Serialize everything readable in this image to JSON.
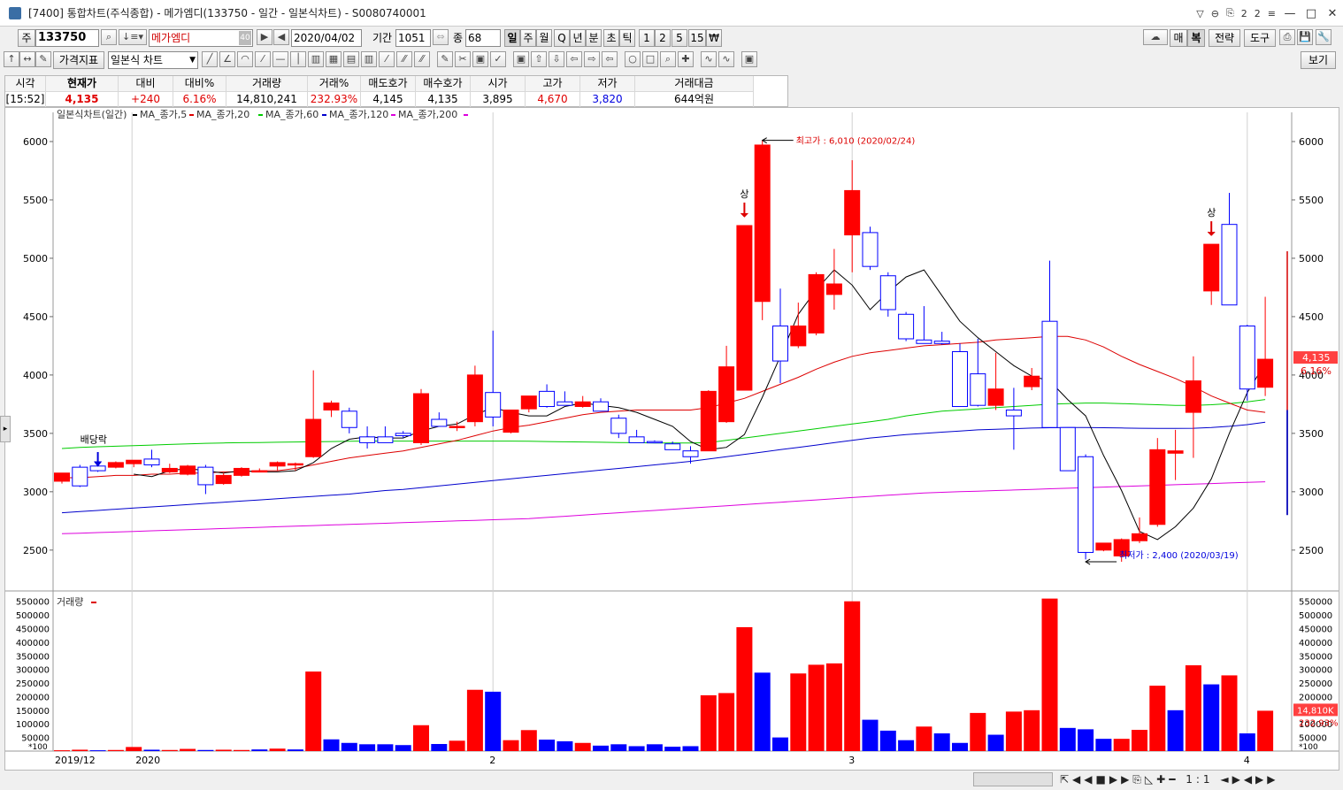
{
  "window": {
    "title": "[7400] 통합차트(주식종합) - 메가엠디(133750 - 일간 - 일본식차트) - S0080740001",
    "title_icons": [
      "▽",
      "⊖",
      "⎘",
      "2",
      "2",
      "≡"
    ],
    "min": "—",
    "max": "□",
    "close": "✕"
  },
  "toolbar1": {
    "code_prefix": "주",
    "code": "133750",
    "name": "메가엠디",
    "name_badge": "40",
    "date": "2020/04/02",
    "period_label": "기간",
    "period": "1051",
    "count_label": "종",
    "count": "68",
    "periods": [
      "일",
      "주",
      "월",
      "Q",
      "년",
      "분",
      "초",
      "틱",
      "1",
      "2",
      "5",
      "15",
      "₩"
    ],
    "right_buttons": [
      "매",
      "복",
      "전략",
      "도구"
    ]
  },
  "toolbar2": {
    "indicator_label": "가격지표",
    "chart_type": "일본식 차트",
    "view_button": "보기"
  },
  "quote": {
    "headers": [
      "시각",
      "현재가",
      "대비",
      "대비%",
      "거래량",
      "거래%",
      "매도호가",
      "매수호가",
      "시가",
      "고가",
      "저가",
      "거래대금"
    ],
    "values": [
      "[15:52]",
      "4,135",
      "+240",
      "6.16%",
      "14,810,241",
      "232.93%",
      "4,145",
      "4,135",
      "3,895",
      "4,670",
      "3,820",
      "644억원"
    ]
  },
  "colors": {
    "up": "#ff0000",
    "down": "#0000ff",
    "ma5": "#000000",
    "ma20": "#dd0000",
    "ma60": "#00cc00",
    "ma120": "#0000cc",
    "ma200": "#dd00dd"
  },
  "chart_data": {
    "type": "candlestick",
    "title": "일본식차트(일간)",
    "legend": [
      "MA_종가,5",
      "MA_종가,20",
      "MA_종가,60",
      "MA_종가,120",
      "MA_종가,200"
    ],
    "y_ticks": [
      6000,
      5500,
      5000,
      4500,
      4000,
      3500,
      3000,
      2500
    ],
    "ylim": [
      2150,
      6250
    ],
    "vol_label": "거래량",
    "vol_ticks": [
      "550000",
      "500000",
      "450000",
      "400000",
      "350000",
      "300000",
      "250000",
      "200000",
      "150000",
      "100000",
      "50000"
    ],
    "vol_ticks_right": [
      "550000",
      "500000",
      "450000",
      "400000",
      "350000",
      "300000",
      "250000",
      "200000",
      "150000",
      "100000",
      "50000"
    ],
    "vol_unit": "*100",
    "vol_max": 575000,
    "x_labels": [
      "2019/12",
      "2020",
      "2",
      "3",
      "4"
    ],
    "annotations": {
      "high": "최고가 : 6,010 (2020/02/24)",
      "low": "최저가 : 2,400 (2020/03/19)",
      "dividend": "배당락",
      "limit_up_1": "상",
      "limit_up_2": "상"
    },
    "last_price_tag": "4,135",
    "last_pct_tag": "6.16%",
    "last_vol_tag": "14,810K",
    "last_volpct_tag": "232.93%",
    "candles": [
      {
        "o": 3090,
        "h": 3160,
        "l": 3070,
        "c": 3160
      },
      {
        "o": 3210,
        "h": 3230,
        "l": 3040,
        "c": 3050
      },
      {
        "o": 3220,
        "h": 3240,
        "l": 3170,
        "c": 3180
      },
      {
        "o": 3210,
        "h": 3260,
        "l": 3200,
        "c": 3250
      },
      {
        "o": 3240,
        "h": 3270,
        "l": 3210,
        "c": 3270
      },
      {
        "o": 3280,
        "h": 3360,
        "l": 3210,
        "c": 3230
      },
      {
        "o": 3170,
        "h": 3240,
        "l": 3160,
        "c": 3200
      },
      {
        "o": 3150,
        "h": 3230,
        "l": 3140,
        "c": 3220
      },
      {
        "o": 3210,
        "h": 3230,
        "l": 2980,
        "c": 3060
      },
      {
        "o": 3070,
        "h": 3160,
        "l": 3060,
        "c": 3140
      },
      {
        "o": 3140,
        "h": 3210,
        "l": 3130,
        "c": 3200
      },
      {
        "o": 3180,
        "h": 3200,
        "l": 3170,
        "c": 3180
      },
      {
        "o": 3220,
        "h": 3260,
        "l": 3180,
        "c": 3250
      },
      {
        "o": 3240,
        "h": 3250,
        "l": 3180,
        "c": 3240
      },
      {
        "o": 3300,
        "h": 4040,
        "l": 3290,
        "c": 3620
      },
      {
        "o": 3700,
        "h": 3780,
        "l": 3640,
        "c": 3760
      },
      {
        "o": 3690,
        "h": 3720,
        "l": 3500,
        "c": 3550
      },
      {
        "o": 3470,
        "h": 3560,
        "l": 3370,
        "c": 3420
      },
      {
        "o": 3470,
        "h": 3560,
        "l": 3420,
        "c": 3420
      },
      {
        "o": 3500,
        "h": 3520,
        "l": 3460,
        "c": 3480
      },
      {
        "o": 3420,
        "h": 3880,
        "l": 3400,
        "c": 3840
      },
      {
        "o": 3620,
        "h": 3680,
        "l": 3560,
        "c": 3560
      },
      {
        "o": 3560,
        "h": 3600,
        "l": 3520,
        "c": 3560
      },
      {
        "o": 3600,
        "h": 4080,
        "l": 3560,
        "c": 4000
      },
      {
        "o": 3850,
        "h": 4380,
        "l": 3560,
        "c": 3640
      },
      {
        "o": 3510,
        "h": 3690,
        "l": 3500,
        "c": 3700
      },
      {
        "o": 3710,
        "h": 3790,
        "l": 3680,
        "c": 3820
      },
      {
        "o": 3860,
        "h": 3920,
        "l": 3720,
        "c": 3730
      },
      {
        "o": 3770,
        "h": 3860,
        "l": 3740,
        "c": 3740
      },
      {
        "o": 3730,
        "h": 3820,
        "l": 3720,
        "c": 3770
      },
      {
        "o": 3770,
        "h": 3800,
        "l": 3690,
        "c": 3690
      },
      {
        "o": 3630,
        "h": 3660,
        "l": 3460,
        "c": 3500
      },
      {
        "o": 3470,
        "h": 3530,
        "l": 3420,
        "c": 3420
      },
      {
        "o": 3430,
        "h": 3440,
        "l": 3420,
        "c": 3420
      },
      {
        "o": 3410,
        "h": 3430,
        "l": 3360,
        "c": 3360
      },
      {
        "o": 3350,
        "h": 3390,
        "l": 3240,
        "c": 3300
      },
      {
        "o": 3350,
        "h": 3870,
        "l": 3350,
        "c": 3860
      },
      {
        "o": 3600,
        "h": 4250,
        "l": 3590,
        "c": 4070
      },
      {
        "o": 3870,
        "h": 5280,
        "l": 3880,
        "c": 5280
      },
      {
        "o": 4630,
        "h": 6010,
        "l": 4470,
        "c": 5970
      },
      {
        "o": 4420,
        "h": 4740,
        "l": 3930,
        "c": 4120
      },
      {
        "o": 4250,
        "h": 4620,
        "l": 4230,
        "c": 4420
      },
      {
        "o": 4360,
        "h": 4880,
        "l": 4340,
        "c": 4860
      },
      {
        "o": 4690,
        "h": 5080,
        "l": 4560,
        "c": 4780
      },
      {
        "o": 5200,
        "h": 5840,
        "l": 4880,
        "c": 5580
      },
      {
        "o": 5220,
        "h": 5270,
        "l": 4900,
        "c": 4930
      },
      {
        "o": 4850,
        "h": 4880,
        "l": 4500,
        "c": 4560
      },
      {
        "o": 4520,
        "h": 4540,
        "l": 4290,
        "c": 4310
      },
      {
        "o": 4300,
        "h": 4590,
        "l": 4270,
        "c": 4270
      },
      {
        "o": 4290,
        "h": 4370,
        "l": 4260,
        "c": 4270
      },
      {
        "o": 4200,
        "h": 4270,
        "l": 3730,
        "c": 3730
      },
      {
        "o": 4010,
        "h": 4310,
        "l": 3730,
        "c": 3740
      },
      {
        "o": 3740,
        "h": 4190,
        "l": 3700,
        "c": 3880
      },
      {
        "o": 3700,
        "h": 3890,
        "l": 3360,
        "c": 3650
      },
      {
        "o": 3900,
        "h": 4060,
        "l": 3870,
        "c": 3990
      },
      {
        "o": 4460,
        "h": 4980,
        "l": 3550,
        "c": 3550
      },
      {
        "o": 3550,
        "h": 3550,
        "l": 3180,
        "c": 3180
      },
      {
        "o": 3300,
        "h": 3320,
        "l": 2420,
        "c": 2480
      },
      {
        "o": 2500,
        "h": 2560,
        "l": 2490,
        "c": 2560
      },
      {
        "o": 2450,
        "h": 2600,
        "l": 2400,
        "c": 2590
      },
      {
        "o": 2580,
        "h": 2780,
        "l": 2560,
        "c": 2640
      },
      {
        "o": 2720,
        "h": 3460,
        "l": 2700,
        "c": 3360
      },
      {
        "o": 3330,
        "h": 3530,
        "l": 3100,
        "c": 3350
      },
      {
        "o": 3680,
        "h": 4160,
        "l": 3290,
        "c": 3950
      },
      {
        "o": 4720,
        "h": 5120,
        "l": 4600,
        "c": 5120
      },
      {
        "o": 5290,
        "h": 5560,
        "l": 4680,
        "c": 4600
      },
      {
        "o": 4420,
        "h": 4430,
        "l": 3780,
        "c": 3880
      },
      {
        "o": 3895,
        "h": 4670,
        "l": 3820,
        "c": 4135
      }
    ],
    "volumes": [
      3000,
      5000,
      3000,
      4000,
      15000,
      5000,
      4000,
      8000,
      4000,
      5000,
      4000,
      6000,
      9000,
      6000,
      292000,
      43000,
      30000,
      25000,
      25000,
      22000,
      95000,
      26000,
      38000,
      225000,
      218000,
      40000,
      77000,
      42000,
      36000,
      30000,
      20000,
      25000,
      18000,
      25000,
      16000,
      18000,
      205000,
      213000,
      455000,
      288000,
      50000,
      285000,
      317000,
      322000,
      550000,
      115000,
      75000,
      40000,
      90000,
      65000,
      30000,
      140000,
      60000,
      145000,
      150000,
      560000,
      85000,
      80000,
      45000,
      45000,
      78000,
      240000,
      150000,
      315000,
      245000,
      278000,
      65000,
      148100
    ],
    "vol_up": [
      1,
      1,
      0,
      1,
      1,
      0,
      1,
      1,
      0,
      1,
      1,
      0,
      1,
      0,
      1,
      0,
      0,
      0,
      0,
      0,
      1,
      0,
      1,
      1,
      0,
      1,
      1,
      0,
      0,
      1,
      0,
      0,
      0,
      0,
      0,
      0,
      1,
      1,
      1,
      0,
      0,
      1,
      1,
      1,
      1,
      0,
      0,
      0,
      1,
      0,
      0,
      1,
      0,
      1,
      1,
      1,
      0,
      0,
      0,
      1,
      1,
      1,
      0,
      1,
      0,
      1,
      0,
      1
    ],
    "ma5": [
      null,
      null,
      null,
      null,
      3150,
      3130,
      3180,
      3200,
      3180,
      3160,
      3180,
      3170,
      3170,
      3180,
      3250,
      3370,
      3450,
      3470,
      3460,
      3460,
      3520,
      3560,
      3580,
      3660,
      3720,
      3680,
      3650,
      3650,
      3730,
      3760,
      3740,
      3720,
      3680,
      3620,
      3560,
      3430,
      3360,
      3380,
      3490,
      3810,
      4160,
      4520,
      4730,
      4900,
      4770,
      4560,
      4710,
      4840,
      4900,
      4680,
      4460,
      4320,
      4200,
      4080,
      3990,
      3950,
      3790,
      3650,
      3310,
      3010,
      2660,
      2590,
      2700,
      2860,
      3110,
      3500,
      3850,
      4100
    ],
    "ma20": [
      3120,
      3120,
      3130,
      3140,
      3140,
      3150,
      3150,
      3160,
      3160,
      3170,
      3170,
      3180,
      3180,
      3200,
      3230,
      3260,
      3290,
      3310,
      3330,
      3350,
      3380,
      3410,
      3440,
      3480,
      3520,
      3550,
      3570,
      3600,
      3630,
      3660,
      3680,
      3690,
      3700,
      3700,
      3700,
      3700,
      3720,
      3760,
      3800,
      3860,
      3920,
      3980,
      4050,
      4110,
      4160,
      4190,
      4210,
      4230,
      4250,
      4260,
      4270,
      4280,
      4300,
      4310,
      4320,
      4330,
      4330,
      4300,
      4240,
      4160,
      4090,
      4030,
      3970,
      3900,
      3820,
      3760,
      3700,
      3680
    ],
    "ma60": [
      3370,
      3380,
      3385,
      3390,
      3395,
      3400,
      3405,
      3410,
      3415,
      3418,
      3420,
      3422,
      3424,
      3426,
      3428,
      3430,
      3432,
      3434,
      3434,
      3434,
      3434,
      3434,
      3434,
      3434,
      3434,
      3434,
      3432,
      3430,
      3428,
      3426,
      3424,
      3422,
      3420,
      3418,
      3418,
      3418,
      3420,
      3440,
      3460,
      3480,
      3500,
      3520,
      3540,
      3560,
      3580,
      3600,
      3620,
      3650,
      3670,
      3690,
      3700,
      3710,
      3720,
      3730,
      3740,
      3750,
      3755,
      3760,
      3760,
      3755,
      3750,
      3745,
      3740,
      3740,
      3745,
      3755,
      3770,
      3790
    ],
    "ma120": [
      2820,
      2830,
      2840,
      2850,
      2860,
      2870,
      2880,
      2890,
      2900,
      2910,
      2920,
      2930,
      2940,
      2950,
      2960,
      2970,
      2980,
      2995,
      3010,
      3020,
      3035,
      3050,
      3065,
      3080,
      3095,
      3110,
      3125,
      3140,
      3155,
      3170,
      3185,
      3200,
      3215,
      3230,
      3245,
      3260,
      3280,
      3300,
      3320,
      3340,
      3360,
      3380,
      3400,
      3420,
      3440,
      3460,
      3475,
      3490,
      3500,
      3510,
      3520,
      3530,
      3535,
      3540,
      3545,
      3548,
      3550,
      3550,
      3548,
      3546,
      3544,
      3542,
      3542,
      3544,
      3550,
      3560,
      3575,
      3595
    ],
    "ma200": [
      2640,
      2645,
      2650,
      2655,
      2660,
      2665,
      2670,
      2675,
      2680,
      2685,
      2690,
      2695,
      2700,
      2705,
      2710,
      2715,
      2720,
      2725,
      2730,
      2735,
      2740,
      2745,
      2750,
      2755,
      2760,
      2765,
      2770,
      2780,
      2790,
      2800,
      2810,
      2820,
      2830,
      2840,
      2850,
      2860,
      2870,
      2880,
      2890,
      2900,
      2910,
      2920,
      2930,
      2940,
      2950,
      2960,
      2970,
      2980,
      2990,
      2995,
      3000,
      3005,
      3010,
      3015,
      3020,
      3025,
      3030,
      3035,
      3040,
      3045,
      3050,
      3055,
      3060,
      3065,
      3070,
      3075,
      3080,
      3085
    ]
  }
}
